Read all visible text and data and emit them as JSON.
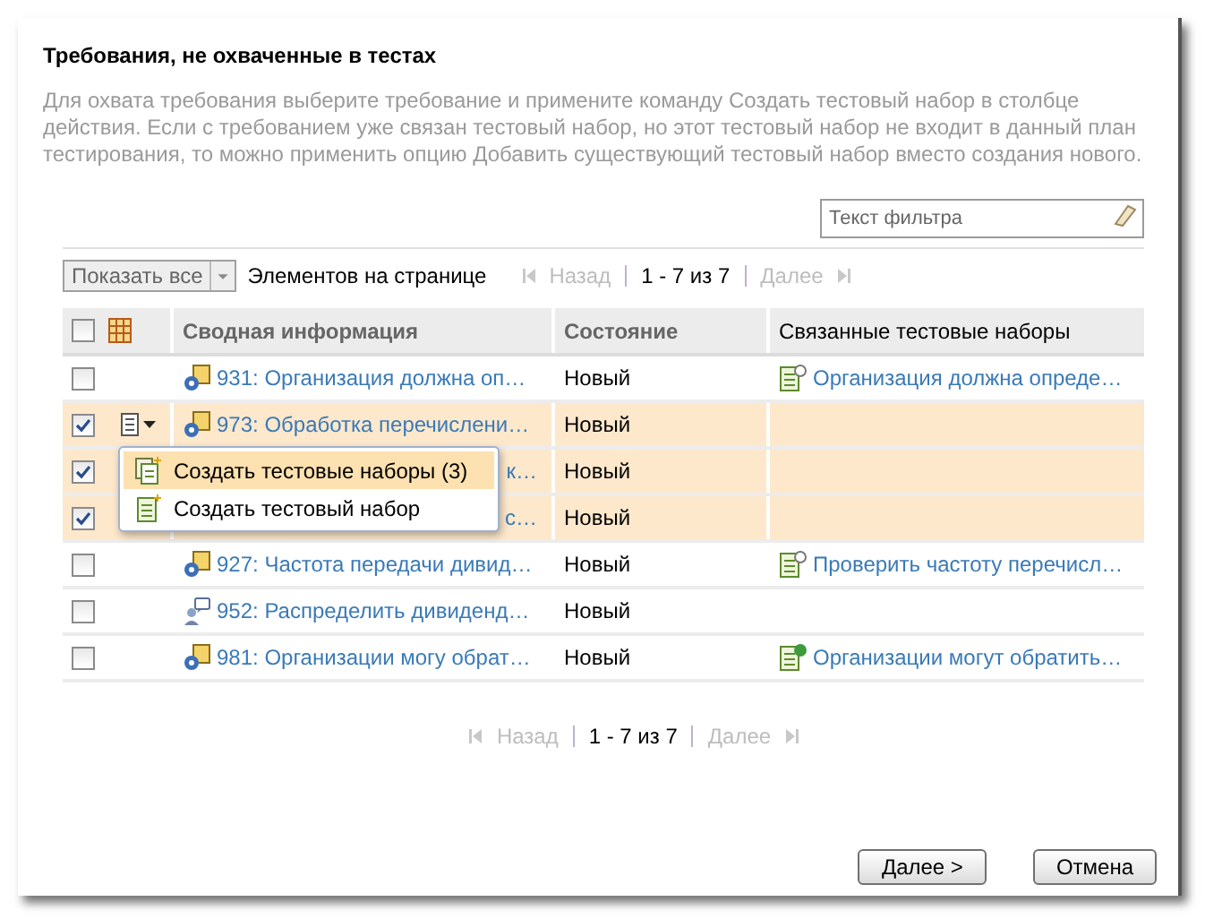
{
  "dialog": {
    "title": "Требования, не охваченные в тестах",
    "description": "Для охвата требования выберите требование и примените команду Создать тестовый набор в столбце действия. Если с требованием уже связан тестовый набор, но этот тестовый набор не входит в данный план тестирования, то можно применить опцию Добавить существующий тестовый набор вместо создания нового."
  },
  "filter": {
    "placeholder": "Текст фильтра"
  },
  "toolbar": {
    "show_all": "Показать все",
    "per_page_label": "Элементов на странице",
    "prev": "Назад",
    "range": "1 - 7 из 7",
    "next": "Далее"
  },
  "table": {
    "columns": [
      "Сводная информация",
      "Состояние",
      "Связанные тестовые наборы"
    ],
    "select_all": false,
    "rows": [
      {
        "selected": false,
        "kind": "gear",
        "summary": "931: Организация должна оп…",
        "state": "Новый",
        "linked": {
          "kind": "review",
          "text": "Организация должна опреде…"
        }
      },
      {
        "selected": true,
        "kind": "gear",
        "summary": "973: Обработка перечислени…",
        "state": "Новый",
        "actions": true
      },
      {
        "selected": true,
        "summary": "к…",
        "state": "Новый"
      },
      {
        "selected": true,
        "summary": "с…",
        "state": "Новый"
      },
      {
        "selected": false,
        "kind": "gear",
        "summary": "927: Частота передачи дивид…",
        "state": "Новый",
        "linked": {
          "kind": "review",
          "text": "Проверить частоту перечисл…"
        }
      },
      {
        "selected": false,
        "kind": "person",
        "summary": "952: Распределить дивиденд…",
        "state": "Новый"
      },
      {
        "selected": false,
        "kind": "gear",
        "summary": "981: Организации могу обрат…",
        "state": "Новый",
        "linked": {
          "kind": "approved",
          "text": "Организации могут обратить…"
        }
      }
    ]
  },
  "menu": {
    "items": [
      {
        "label": "Создать тестовые наборы (3)",
        "selected": true,
        "kind": "multi"
      },
      {
        "label": "Создать тестовый набор",
        "selected": false,
        "kind": "single"
      }
    ]
  },
  "bottom_pager": {
    "prev": "Назад",
    "range": "1 - 7 из 7",
    "next": "Далее"
  },
  "buttons": [
    "Далее >",
    "Отмена"
  ]
}
